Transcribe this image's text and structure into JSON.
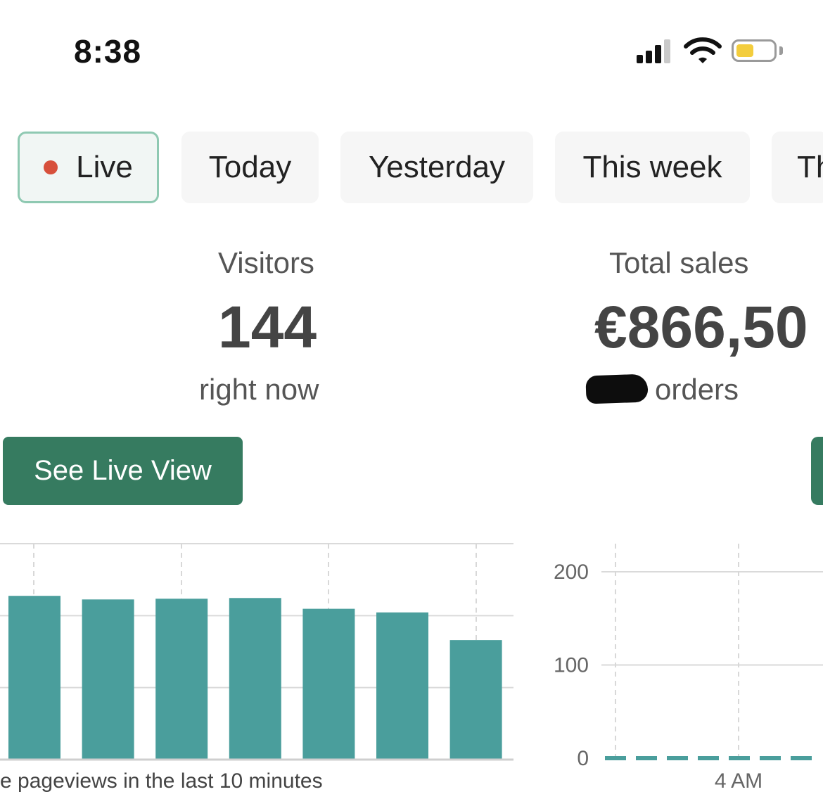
{
  "status_bar": {
    "time": "8:38"
  },
  "tabs": [
    {
      "label": "Live",
      "active": true
    },
    {
      "label": "Today",
      "active": false
    },
    {
      "label": "Yesterday",
      "active": false
    },
    {
      "label": "This week",
      "active": false
    },
    {
      "label": "Th",
      "active": false
    }
  ],
  "metrics": {
    "visitors": {
      "label": "Visitors",
      "value": "144",
      "sub": "right now"
    },
    "sales": {
      "label": "Total sales",
      "value": "€866,50",
      "sub": "orders"
    }
  },
  "buttons": {
    "live_view": "See Live View"
  },
  "colors": {
    "accent": "#367b60",
    "bar": "#4a9e9c",
    "live_dot": "#d7503b"
  },
  "chart_data": [
    {
      "type": "bar",
      "title": "",
      "caption": "e pageviews in the last 10 minutes",
      "values": [
        45.5,
        44.5,
        44.7,
        44.9,
        41.9,
        40.9,
        33.2
      ],
      "ylim": [
        0,
        60
      ],
      "grid": true
    },
    {
      "type": "line",
      "title": "",
      "yticks": [
        "200",
        "100",
        "0"
      ],
      "ylim": [
        0,
        200
      ],
      "xticks": [
        "4 AM"
      ],
      "values": [
        0,
        0,
        0,
        0,
        0,
        0,
        0,
        0
      ],
      "grid": true
    }
  ]
}
